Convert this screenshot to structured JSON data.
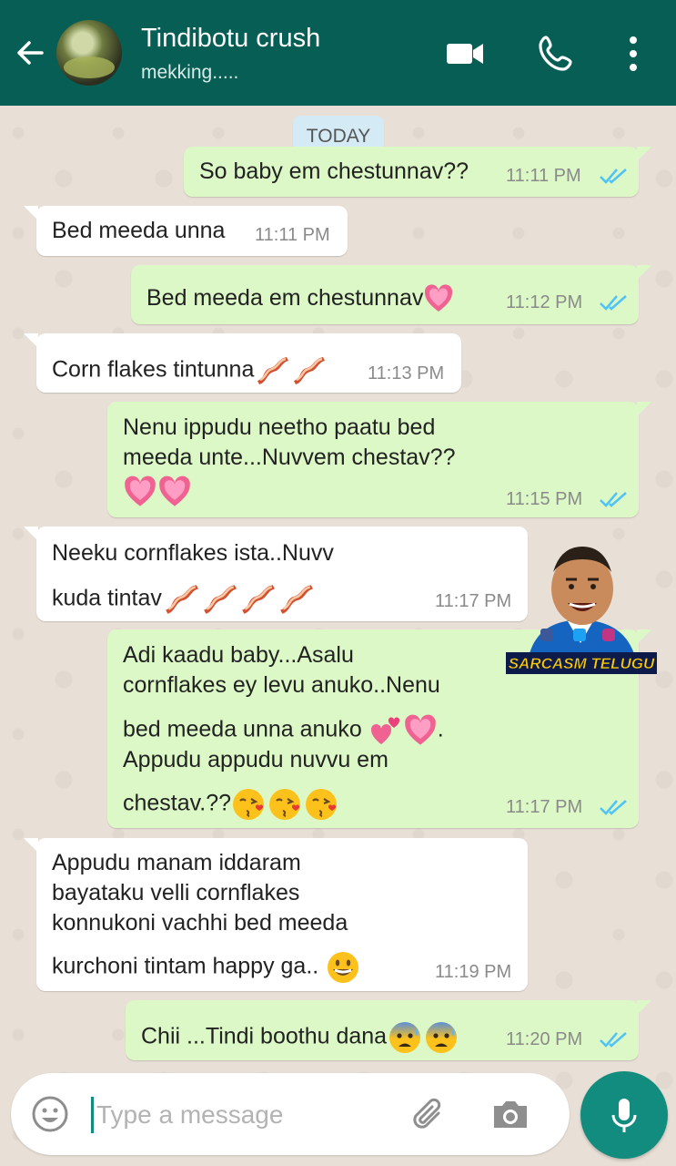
{
  "header": {
    "contact_name": "Tindibotu crush",
    "status": "mekking....."
  },
  "date_label": "TODAY",
  "messages": [
    {
      "lines": [
        "So baby em chestunnav??"
      ],
      "time": "11:11 PM"
    },
    {
      "lines": [
        "Bed meeda unna"
      ],
      "time": "11:11 PM"
    },
    {
      "lines": [
        "Bed meeda em chestunnav"
      ],
      "time": "11:12 PM"
    },
    {
      "lines": [
        "Corn flakes tintunna"
      ],
      "time": "11:13 PM"
    },
    {
      "lines": [
        "Nenu ippudu neetho paatu bed",
        "meeda unte...Nuvvem chestav??"
      ],
      "time": "11:15 PM"
    },
    {
      "lines": [
        "Neeku cornflakes ista..Nuvv",
        "kuda tintav"
      ],
      "time": "11:17 PM"
    },
    {
      "lines": [
        "Adi kaadu baby...Asalu",
        "cornflakes ey levu anuko..Nenu",
        "bed meeda unna anuko",
        ".",
        "Appudu appudu nuvvu em",
        "chestav.??"
      ],
      "time": "11:17 PM"
    },
    {
      "lines": [
        "Appudu manam iddaram",
        "bayataku velli cornflakes",
        "konnukoni vachhi bed meeda",
        "kurchoni tintam happy ga.."
      ],
      "time": "11:19 PM"
    },
    {
      "lines": [
        "Chii ...Tindi boothu dana"
      ],
      "time": "11:20 PM"
    }
  ],
  "sticker": {
    "caption": "SARCASM TELUGU"
  },
  "input": {
    "placeholder": "Type a message"
  },
  "colors": {
    "header": "#075e54",
    "outgoing": "#dcf8c6",
    "incoming": "#ffffff",
    "accent": "#128c7e",
    "tick": "#4fc3f7"
  }
}
